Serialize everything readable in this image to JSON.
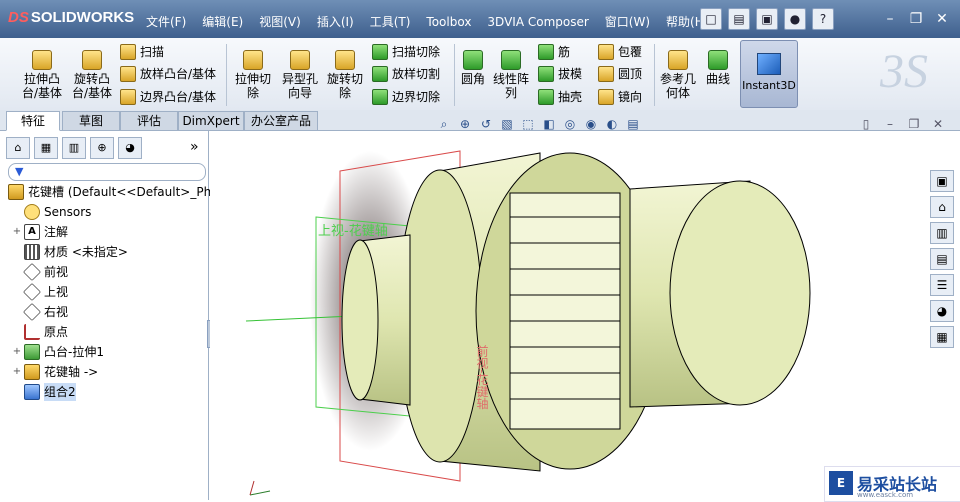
{
  "app": {
    "logo_text": "SOLIDWORKS",
    "logo_prefix": "DS"
  },
  "menu": [
    "文件(F)",
    "编辑(E)",
    "视图(V)",
    "插入(I)",
    "工具(T)",
    "Toolbox",
    "3DVIA Composer",
    "窗口(W)",
    "帮助(H)"
  ],
  "ribbon": {
    "extrude_boss": "拉伸凸\n台/基体",
    "revolve_boss": "旋转凸\n台/基体",
    "sweep": "扫描",
    "loft": "放样凸台/基体",
    "boundary_boss": "边界凸台/基体",
    "extrude_cut": "拉伸切\n除",
    "hole_wizard": "异型孔\n向导",
    "revolve_cut": "旋转切\n除",
    "sweep_cut": "扫描切除",
    "loft_cut": "放样切割",
    "boundary_cut": "边界切除",
    "fillet": "圆角",
    "linear_pattern": "线性阵\n列",
    "rib": "筋",
    "draft": "拔模",
    "shell": "抽壳",
    "wrap": "包覆",
    "dome": "圆顶",
    "mirror": "镜向",
    "ref_geometry": "参考几\n何体",
    "curves": "曲线",
    "instant3d": "Instant3D"
  },
  "tabs": [
    "特征",
    "草图",
    "评估",
    "DimXpert",
    "办公室产品"
  ],
  "tree": {
    "root": "花键槽  (Default<<Default>_Ph",
    "items": [
      {
        "label": "Sensors",
        "icon": "sensor",
        "expand": ""
      },
      {
        "label": "注解",
        "icon": "note",
        "expand": "+"
      },
      {
        "label": "材质 <未指定>",
        "icon": "mat",
        "expand": ""
      },
      {
        "label": "前视",
        "icon": "plane",
        "expand": ""
      },
      {
        "label": "上视",
        "icon": "plane",
        "expand": ""
      },
      {
        "label": "右视",
        "icon": "plane",
        "expand": ""
      },
      {
        "label": "原点",
        "icon": "origin",
        "expand": ""
      },
      {
        "label": "凸台-拉伸1",
        "icon": "boss",
        "expand": "+"
      },
      {
        "label": "花键轴 ->",
        "icon": "part",
        "expand": "+"
      },
      {
        "label": "组合2",
        "icon": "group",
        "expand": ""
      }
    ]
  },
  "viewport": {
    "plane_label_top": "上视-花键轴",
    "plane_label_front": "前视-花键轴"
  },
  "watermark": {
    "title": "易采站长站",
    "url": "www.easck.com",
    "logo": "E"
  },
  "colors": {
    "titlebar": "#3e5f8d",
    "part_fill": "#e6ecbf",
    "plane_red": "#d94a4a",
    "plane_green": "#4ccf4c",
    "tree_selected": "#c8dcf6"
  }
}
